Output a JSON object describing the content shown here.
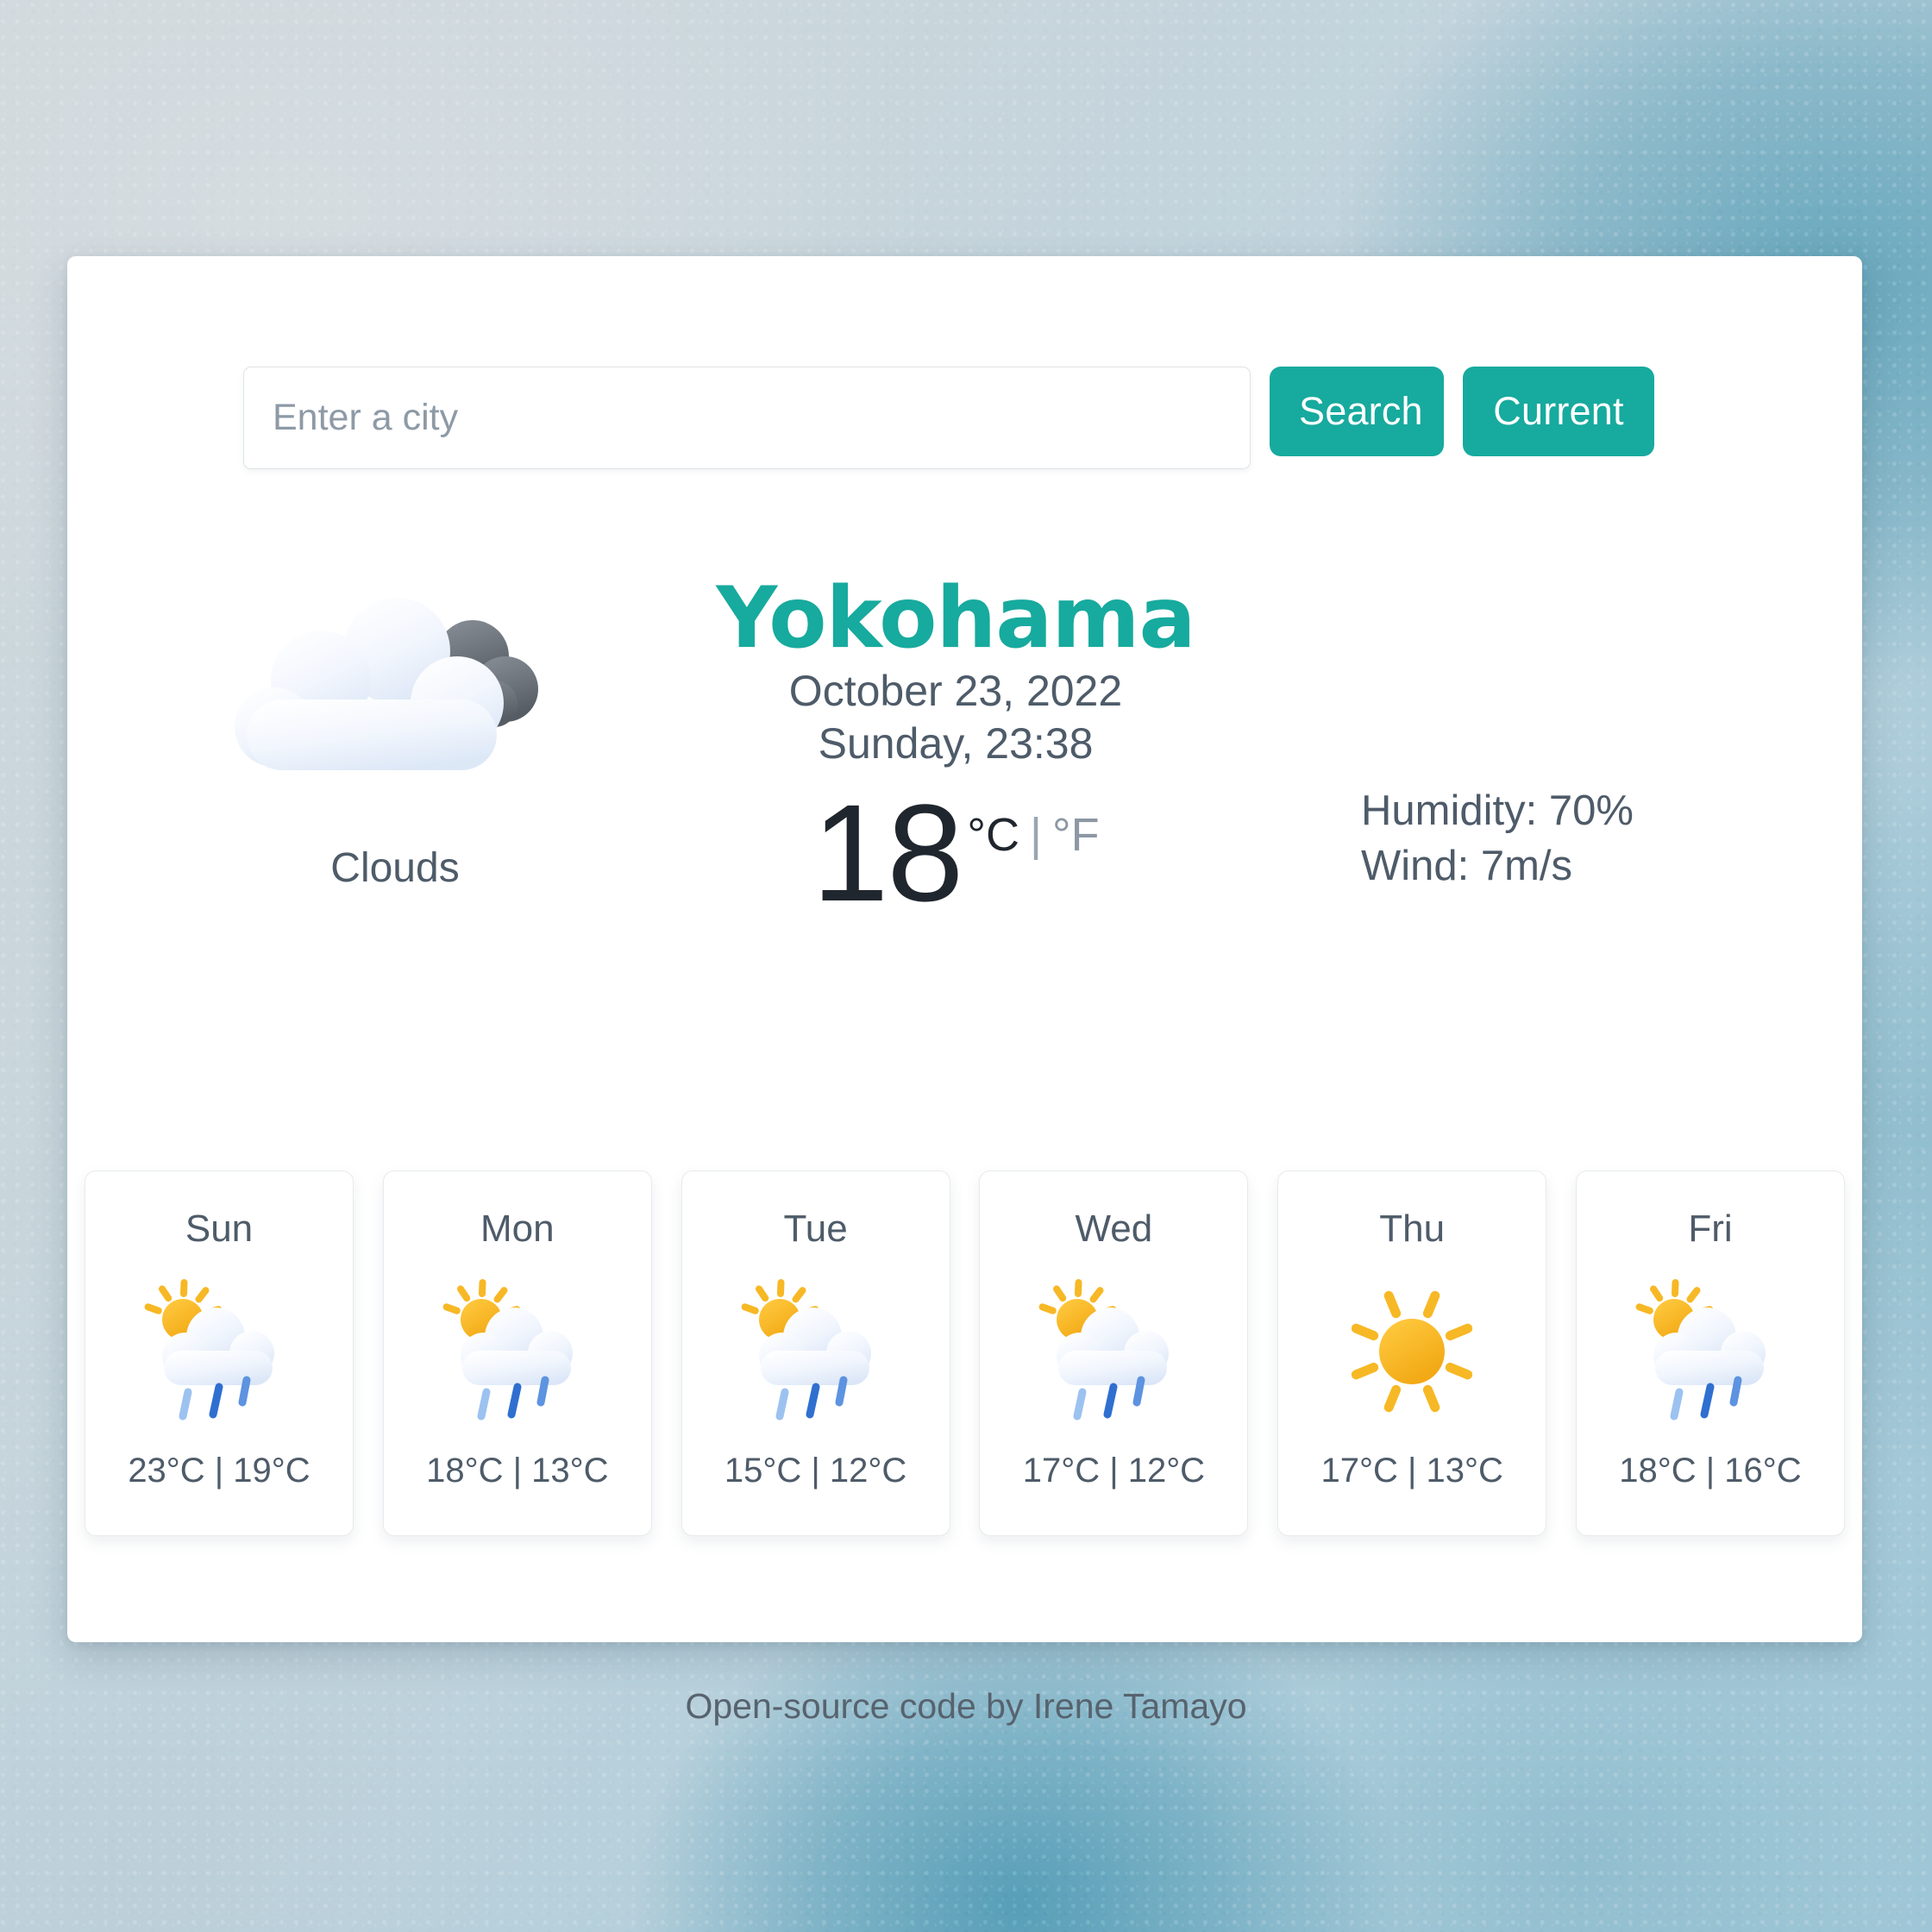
{
  "theme": {
    "accent": "#17aa9e",
    "text_primary": "#20262e",
    "text_secondary": "#4e5b69",
    "text_muted": "#8d98a4",
    "card_background": "#ffffff",
    "sun_yellow": "#f5ac1d",
    "rain_blue": "#2f6fd0",
    "cloud_light": "#eaf1fb",
    "cloud_dark": "#6c727a"
  },
  "search": {
    "placeholder": "Enter a city",
    "value": "",
    "search_label": "Search",
    "current_label": "Current"
  },
  "current": {
    "city": "Yokohama",
    "date": "October 23, 2022",
    "time": "Sunday, 23:38",
    "description": "Clouds",
    "icon": "clouds-icon",
    "temperature": "18",
    "unit_celsius": "°C",
    "unit_separator": "|",
    "unit_fahrenheit": "°F",
    "active_unit": "celsius",
    "humidity": "Humidity: 70%",
    "wind": "Wind: 7m/s"
  },
  "forecast": [
    {
      "day": "Sun",
      "icon": "sun-behind-rain-cloud-icon",
      "temps": "23°C | 19°C",
      "high": "23°C",
      "low": "19°C"
    },
    {
      "day": "Mon",
      "icon": "sun-behind-rain-cloud-icon",
      "temps": "18°C | 13°C",
      "high": "18°C",
      "low": "13°C"
    },
    {
      "day": "Tue",
      "icon": "sun-behind-rain-cloud-icon",
      "temps": "15°C | 12°C",
      "high": "15°C",
      "low": "12°C"
    },
    {
      "day": "Wed",
      "icon": "sun-behind-rain-cloud-icon",
      "temps": "17°C | 12°C",
      "high": "17°C",
      "low": "12°C"
    },
    {
      "day": "Thu",
      "icon": "sun-icon",
      "temps": "17°C | 13°C",
      "high": "17°C",
      "low": "13°C"
    },
    {
      "day": "Fri",
      "icon": "sun-behind-rain-cloud-icon",
      "temps": "18°C | 16°C",
      "high": "18°C",
      "low": "16°C"
    }
  ],
  "footer": {
    "credit": "Open-source code by Irene Tamayo"
  }
}
